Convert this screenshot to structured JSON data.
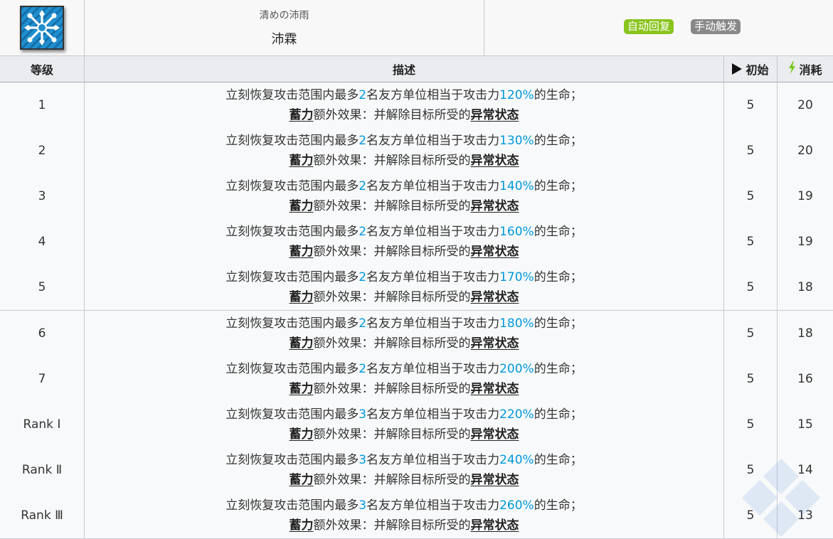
{
  "skill": {
    "icon": "snowflake-cross-icon",
    "subtitle": "清めの沛雨",
    "name": "沛霖",
    "tags": {
      "auto": "自动回复",
      "manual": "手动触发"
    },
    "colors": {
      "auto_tag": "#8ac41e",
      "manual_tag": "#888888",
      "highlight": "#0098dc"
    }
  },
  "table": {
    "headers": {
      "level": "等级",
      "desc": "描述",
      "init": "初始",
      "cost": "消耗"
    },
    "desc_text": {
      "a": "立刻恢复攻击范围内最多",
      "b": "名友方单位相当于攻击力",
      "c": "的生命；",
      "kw1": "蓄力",
      "d": "额外效果：并解除目标所受的",
      "kw2": "异常状态"
    },
    "rows": [
      {
        "level": "1",
        "count": "2",
        "pct": "120%",
        "init": "5",
        "cost": "20"
      },
      {
        "level": "2",
        "count": "2",
        "pct": "130%",
        "init": "5",
        "cost": "20"
      },
      {
        "level": "3",
        "count": "2",
        "pct": "140%",
        "init": "5",
        "cost": "19"
      },
      {
        "level": "4",
        "count": "2",
        "pct": "160%",
        "init": "5",
        "cost": "19"
      },
      {
        "level": "5",
        "count": "2",
        "pct": "170%",
        "init": "5",
        "cost": "18"
      },
      {
        "level": "6",
        "count": "2",
        "pct": "180%",
        "init": "5",
        "cost": "18"
      },
      {
        "level": "7",
        "count": "2",
        "pct": "200%",
        "init": "5",
        "cost": "16"
      },
      {
        "level": "Rank Ⅰ",
        "count": "3",
        "pct": "220%",
        "init": "5",
        "cost": "15"
      },
      {
        "level": "Rank Ⅱ",
        "count": "3",
        "pct": "240%",
        "init": "5",
        "cost": "14"
      },
      {
        "level": "Rank Ⅲ",
        "count": "3",
        "pct": "260%",
        "init": "5",
        "cost": "13"
      }
    ]
  }
}
